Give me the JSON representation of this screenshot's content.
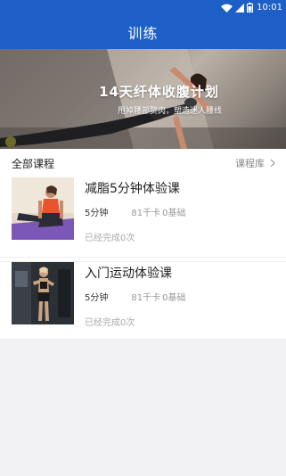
{
  "status_bar": {
    "time": "10:01"
  },
  "app_bar": {
    "title": "训练"
  },
  "banner": {
    "title": "14天纤体收腹计划",
    "subtitle": "甩掉腰部赘肉，塑造迷人腰线"
  },
  "section": {
    "title": "全部课程",
    "link_label": "课程库"
  },
  "courses": [
    {
      "name": "减脂5分钟体验课",
      "duration": "5分钟",
      "calories": "81千卡",
      "level": "0基础",
      "progress": "已经完成0次"
    },
    {
      "name": "入门运动体验课",
      "duration": "5分钟",
      "calories": "81千卡",
      "level": "0基础",
      "progress": "已经完成0次"
    }
  ],
  "colors": {
    "primary": "#1d5fc7"
  }
}
